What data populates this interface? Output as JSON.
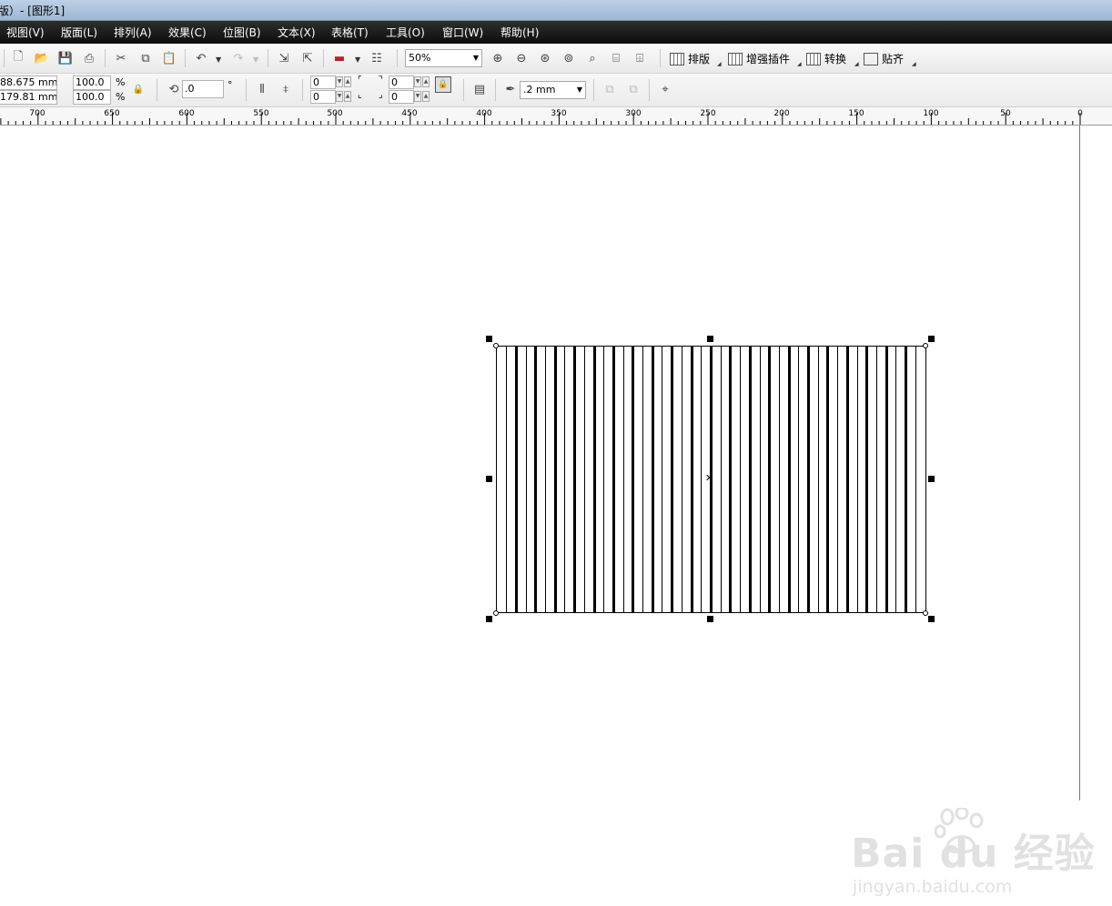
{
  "window": {
    "title": "版）- [图形1]"
  },
  "menu": [
    {
      "label": "视图(V)"
    },
    {
      "label": "版面(L)"
    },
    {
      "label": "排列(A)"
    },
    {
      "label": "效果(C)"
    },
    {
      "label": "位图(B)"
    },
    {
      "label": "文本(X)"
    },
    {
      "label": "表格(T)"
    },
    {
      "label": "工具(O)"
    },
    {
      "label": "窗口(W)"
    },
    {
      "label": "帮助(H)"
    }
  ],
  "toolbar": {
    "zoom_value": "50%",
    "plugins": [
      {
        "label": "排版"
      },
      {
        "label": "增强插件"
      },
      {
        "label": "转换"
      },
      {
        "label": "贴齐"
      }
    ]
  },
  "property_bar": {
    "width": "88.675 mm",
    "height": "179.81 mm",
    "scale_x": "100.0",
    "scale_y": "100.0",
    "percent": "%",
    "angle": ".0",
    "degree": "°",
    "corner_tl": "0",
    "corner_bl": "0",
    "corner_tr": "0",
    "corner_br": "0",
    "outline_width": ".2 mm"
  },
  "ruler": {
    "labels": [
      "700",
      "650",
      "600",
      "550",
      "500",
      "450",
      "400",
      "350",
      "300",
      "250",
      "200",
      "150",
      "100",
      "50",
      "0"
    ]
  },
  "shape": {
    "stripe_count": 44,
    "fill_pattern": "vertical-stripes",
    "stroke_color": "#000000"
  },
  "watermark": {
    "brand": "Bai du 经验",
    "site": "jingyan.baidu.com"
  }
}
